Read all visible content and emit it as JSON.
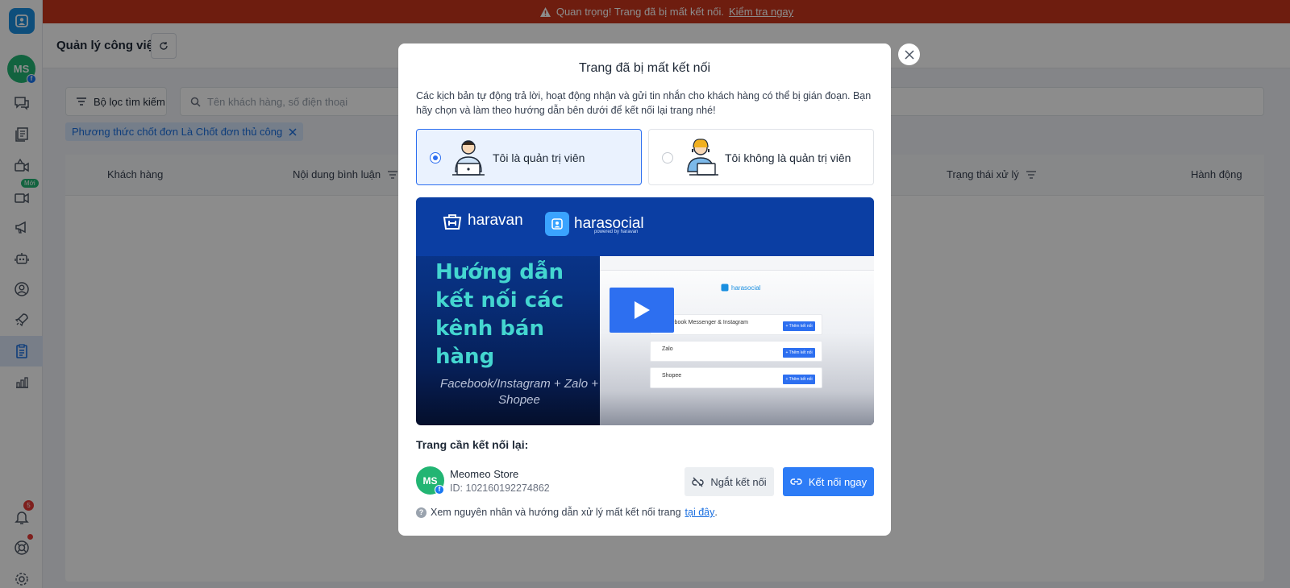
{
  "alert": {
    "message": "Quan trọng! Trang đã bị mất kết nối.",
    "link": "Kiểm tra ngay"
  },
  "sidebar": {
    "avatar_initials": "MS",
    "new_badge": "Mới",
    "notification_count": "5"
  },
  "page": {
    "title": "Quản lý công việc",
    "filter_button": "Bộ lọc tìm kiếm",
    "search_placeholder": "Tên khách hàng, số điện thoại",
    "active_filter": "Phương thức chốt đơn Là Chốt đơn thủ công",
    "columns": [
      "Khách hàng",
      "Nội dung bình luận",
      "Trạng thái xử lý",
      "Hành động"
    ]
  },
  "modal": {
    "title": "Trang đã bị mất kết nối",
    "description": "Các kịch bản tự động trả lời, hoạt động nhận và gửi tin nhắn cho khách hàng có thể bị gián đoạn. Bạn hãy chọn và làm theo hướng dẫn bên dưới để kết nối lại trang nhé!",
    "roles": [
      {
        "label": "Tôi là quản trị viên",
        "selected": true
      },
      {
        "label": "Tôi không là quản trị viên",
        "selected": false
      }
    ],
    "video": {
      "brand_1": "haravan",
      "brand_2": "harasocial",
      "brand_2_sub": "powered by haravan",
      "heading": "Hướng dẫn kết nối các kênh bán hàng",
      "subheading": "Facebook/Instagram + Zalo + Shopee",
      "screen_logo": "harasocial",
      "screen_rows": [
        {
          "name": "Facebook Messenger & Instagram",
          "button": "+ Thêm kết nối"
        },
        {
          "name": "Zalo",
          "button": "+ Thêm kết nối"
        },
        {
          "name": "Shopee",
          "button": "+ Thêm kết nối"
        }
      ]
    },
    "reconnect_label": "Trang cần kết nối lại:",
    "page_initials": "MS",
    "page_name": "Meomeo Store",
    "page_id": "ID: 102160192274862",
    "disconnect_button": "Ngắt kết nối",
    "connect_button": "Kết nối ngay",
    "help_text": "Xem nguyên nhân và hướng dẫn xử lý mất kết nối trang",
    "help_link": "tại đây",
    "help_end": "."
  },
  "colors": {
    "alert": "#c8361c",
    "primary": "#2d7cf6",
    "avatar": "#22b573"
  }
}
